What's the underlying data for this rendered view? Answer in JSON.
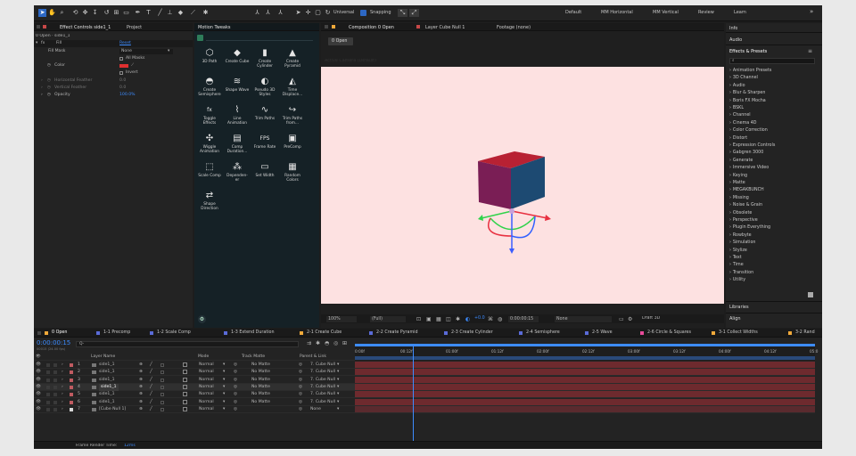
{
  "toolbar": {
    "tools": [
      "select-arrow",
      "hand",
      "zoom",
      "orbit",
      "pan-camera",
      "dolly",
      "rect",
      "pen",
      "type",
      "brush",
      "clone",
      "eraser",
      "roto",
      "puppet"
    ],
    "universal_label": "Universal",
    "snapping_label": "Snapping",
    "workspaces": [
      "Default",
      "MM Horizontal",
      "MM Vertical",
      "Review",
      "Learn"
    ],
    "more": "»"
  },
  "effect_controls": {
    "tab": "Effect Controls side1_1",
    "tab2": "Project",
    "subtitle": "0 Open · side1_1",
    "fx_name": "Fill",
    "reset": "Reset",
    "rows": [
      {
        "label": "Fill Mask",
        "value": "None"
      },
      {
        "label": "",
        "value": "All Masks"
      },
      {
        "label": "Color",
        "value": ""
      },
      {
        "label": "",
        "value": "Invert"
      },
      {
        "label": "Horizontal Feather",
        "value": "0.0"
      },
      {
        "label": "Vertical Feather",
        "value": "0.0"
      },
      {
        "label": "Opacity",
        "value": "100.0%"
      }
    ]
  },
  "motion_tweaks": {
    "title": "Motion Tweaks",
    "items": [
      {
        "label": "3D Path",
        "icon": "cube-path-icon",
        "glyph": "⬡"
      },
      {
        "label": "Create Cube",
        "icon": "cube-icon",
        "glyph": "◆"
      },
      {
        "label": "Create Cylinder",
        "icon": "cylinder-icon",
        "glyph": "▮"
      },
      {
        "label": "Create Pyramid",
        "icon": "pyramid-icon",
        "glyph": "▲"
      },
      {
        "label": "Create Semisphere",
        "icon": "semisphere-icon",
        "glyph": "◓"
      },
      {
        "label": "Shape Wave",
        "icon": "wave-icon",
        "glyph": "≋"
      },
      {
        "label": "Pseudo 3D Styles",
        "icon": "pseudo3d-icon",
        "glyph": "◐"
      },
      {
        "label": "Time Displace...",
        "icon": "displace-icon",
        "glyph": "◭"
      },
      {
        "label": "Toggle Effects",
        "icon": "fx-icon",
        "glyph": "fx"
      },
      {
        "label": "Line Animation",
        "icon": "line-anim-icon",
        "glyph": "⌇"
      },
      {
        "label": "Trim Paths",
        "icon": "trim-paths-icon",
        "glyph": "∿"
      },
      {
        "label": "Trim Paths from...",
        "icon": "trim-from-icon",
        "glyph": "↪"
      },
      {
        "label": "Wiggle Animation",
        "icon": "wiggle-icon",
        "glyph": "✣"
      },
      {
        "label": "Comp Duration...",
        "icon": "duration-icon",
        "glyph": "▤"
      },
      {
        "label": "Frame Rate",
        "icon": "fps-icon",
        "glyph": "FPS"
      },
      {
        "label": "PreComp",
        "icon": "precomp-icon",
        "glyph": "▣"
      },
      {
        "label": "Scale Comp",
        "icon": "scale-icon",
        "glyph": "⬚"
      },
      {
        "label": "Dependen-er",
        "icon": "dependency-icon",
        "glyph": "⁂"
      },
      {
        "label": "Set Width",
        "icon": "width-icon",
        "glyph": "▭"
      },
      {
        "label": "Random Colors",
        "icon": "random-colors-icon",
        "glyph": "▦"
      },
      {
        "label": "Shape Direction",
        "icon": "direction-icon",
        "glyph": "⇄"
      }
    ]
  },
  "composition": {
    "tabs": [
      "Composition 0 Open",
      "Layer Cube Null 1",
      "Footage (none)"
    ],
    "comp_button": "0 Open",
    "camera_label": "Active Camera (Default)",
    "zoom": "100%",
    "resolution": "(Full)",
    "exposure": "+0.0",
    "timecode": "0:00:00:15",
    "view": "None",
    "renderer": "Draft 3D"
  },
  "effects_panel": {
    "tabs": [
      "Info",
      "Audio",
      "Effects & Presets"
    ],
    "items": [
      "Animation Presets",
      "3D Channel",
      "Audio",
      "Blur & Sharpen",
      "Boris FX Mocha",
      "BSKL",
      "Channel",
      "Cinema 4D",
      "Color Correction",
      "Distort",
      "Expression Controls",
      "Gabgren 3000",
      "Generate",
      "Immersive Video",
      "Keying",
      "Matte",
      "MEGAKBUNCH",
      "Missing",
      "Noise & Grain",
      "Obsolete",
      "Perspective",
      "Plugin Everything",
      "Rowbyte",
      "Simulation",
      "Stylize",
      "Text",
      "Time",
      "Transition",
      "Utility"
    ],
    "bottom_tabs": [
      "Libraries",
      "Align"
    ]
  },
  "timeline": {
    "tabs": [
      {
        "label": "0 Open",
        "color": "#f0a93a"
      },
      {
        "label": "1-1 Precomp",
        "color": "#5a6bd8"
      },
      {
        "label": "1-2 Scale Comp",
        "color": "#5a6bd8"
      },
      {
        "label": "1-3 Extend Duration",
        "color": "#5a6bd8"
      },
      {
        "label": "2-1 Create Cube",
        "color": "#f0a93a"
      },
      {
        "label": "2-2 Create Pyramid",
        "color": "#5a6bd8"
      },
      {
        "label": "2-3 Create Cylinder",
        "color": "#5a6bd8"
      },
      {
        "label": "2-4 Semisphere",
        "color": "#5a6bd8"
      },
      {
        "label": "2-5 Wave",
        "color": "#5a6bd8"
      },
      {
        "label": "2-6 Circle & Squares",
        "color": "#e94b9a"
      },
      {
        "label": "3-1 Collect Widths",
        "color": "#f0a93a"
      },
      {
        "label": "3-2 Rand",
        "color": "#f0a93a"
      }
    ],
    "timecode": "0:00:00:15",
    "timecode_sub": "00015 (24.00 fps)",
    "search_placeholder": "Q-",
    "columns": {
      "layer_name": "Layer Name",
      "mode": "Mode",
      "track_matte": "Track Matte",
      "parent": "Parent & Link"
    },
    "layers": [
      {
        "num": "1",
        "name": "side1_1",
        "mode": "Normal",
        "matte": "No Matte",
        "parent": "7. Cube Null",
        "color": "#c05b61",
        "selected": false
      },
      {
        "num": "2",
        "name": "side1_1",
        "mode": "Normal",
        "matte": "No Matte",
        "parent": "7. Cube Null",
        "color": "#c05b61",
        "selected": false
      },
      {
        "num": "3",
        "name": "side1_1",
        "mode": "Normal",
        "matte": "No Matte",
        "parent": "7. Cube Null",
        "color": "#c05b61",
        "selected": false
      },
      {
        "num": "4",
        "name": "side1_1",
        "mode": "Normal",
        "matte": "No Matte",
        "parent": "7. Cube Null",
        "color": "#c05b61",
        "selected": true
      },
      {
        "num": "5",
        "name": "side1_1",
        "mode": "Normal",
        "matte": "No Matte",
        "parent": "7. Cube Null",
        "color": "#c05b61",
        "selected": false
      },
      {
        "num": "6",
        "name": "side1_1",
        "mode": "Normal",
        "matte": "No Matte",
        "parent": "7. Cube Null",
        "color": "#c05b61",
        "selected": false
      },
      {
        "num": "7",
        "name": "[Cube Null 1]",
        "mode": "Normal",
        "matte": "",
        "parent": "None",
        "color": "#d8d8d8",
        "selected": false
      }
    ],
    "ruler": [
      "0:00f",
      "00:12f",
      "01:00f",
      "01:12f",
      "02:00f",
      "02:12f",
      "03:00f",
      "03:12f",
      "04:00f",
      "04:12f",
      "05:0"
    ],
    "playhead_fraction": 0.125,
    "render_label": "Frame Render Time:",
    "render_value": "12ms"
  },
  "colors": {
    "accent": "#2d8ceb",
    "track": "#6e2a2e",
    "viewer": "#fde1e1"
  }
}
